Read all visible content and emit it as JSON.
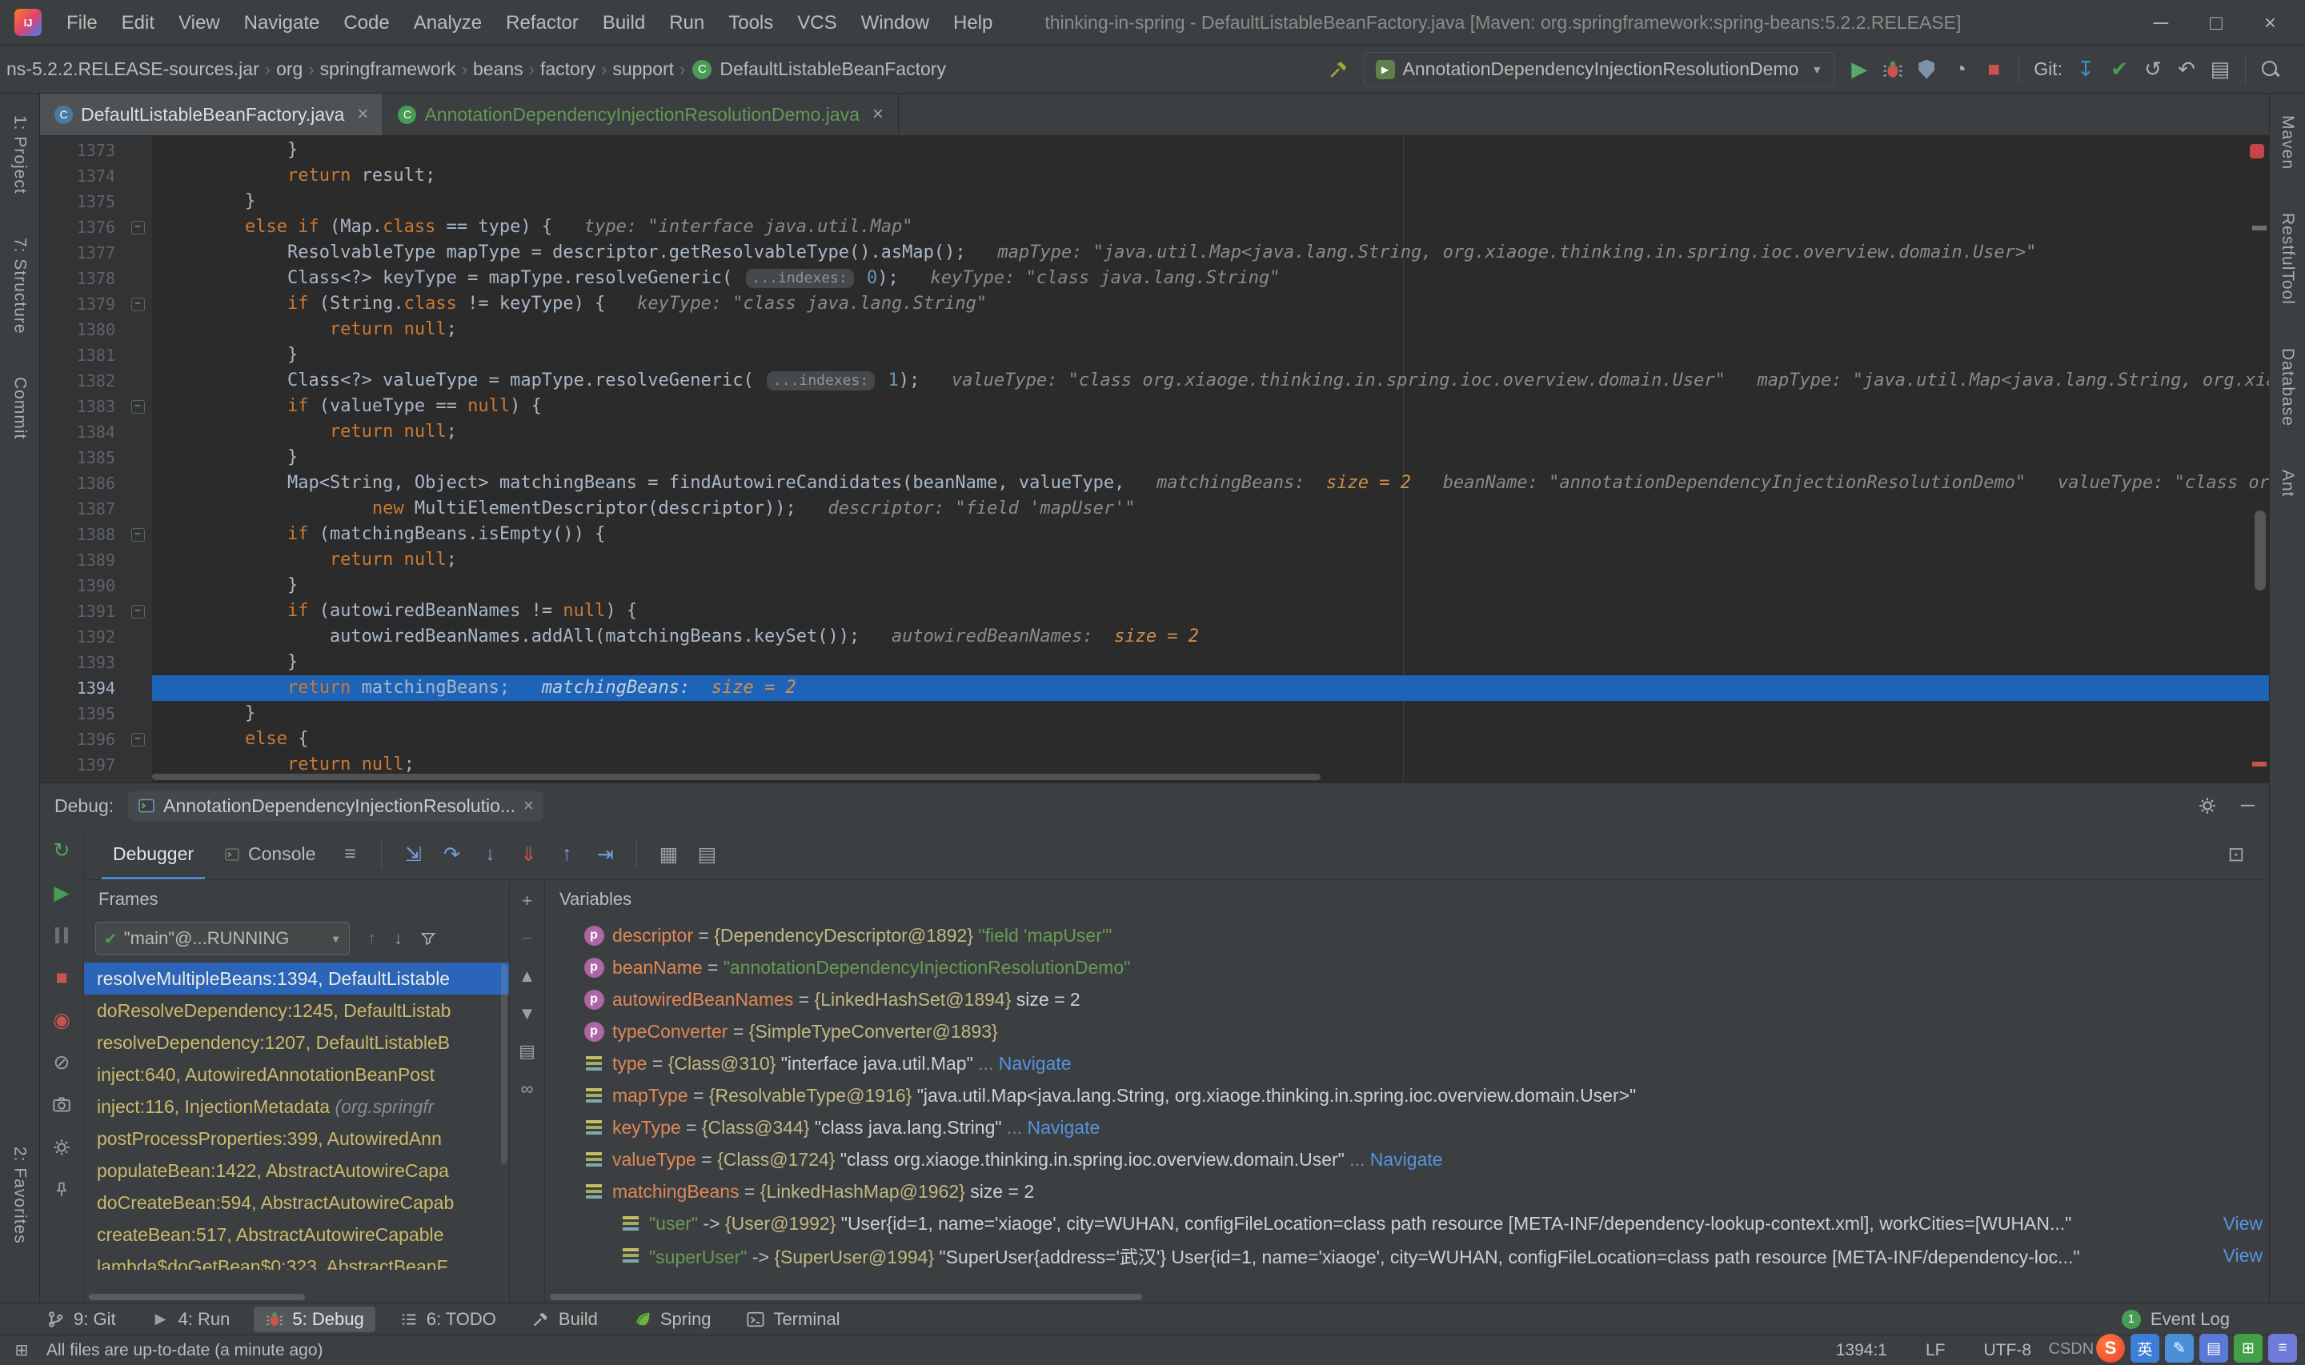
{
  "window": {
    "title": "thinking-in-spring - DefaultListableBeanFactory.java [Maven: org.springframework:spring-beans:5.2.2.RELEASE]",
    "controls": {
      "minimize": "─",
      "maximize": "□",
      "close": "×"
    }
  },
  "menu": {
    "items": [
      "File",
      "Edit",
      "View",
      "Navigate",
      "Code",
      "Analyze",
      "Refactor",
      "Build",
      "Run",
      "Tools",
      "VCS",
      "Window",
      "Help"
    ]
  },
  "navbar": {
    "breadcrumbs": [
      "ns-5.2.2.RELEASE-sources.jar",
      "org",
      "springframework",
      "beans",
      "factory",
      "support"
    ],
    "breadcrumb_class": "DefaultListableBeanFactory",
    "run_config": "AnnotationDependencyInjectionResolutionDemo",
    "git_label": "Git:"
  },
  "tabs": [
    {
      "label": "DefaultListableBeanFactory.java",
      "close": "×",
      "active": true,
      "color": "#4A7A9F",
      "green": false
    },
    {
      "label": "AnnotationDependencyInjectionResolutionDemo.java",
      "close": "×",
      "active": false,
      "color": "#499C54",
      "green": true
    }
  ],
  "left_stripe": {
    "top": [
      "1: Project",
      "7: Structure",
      "Commit"
    ],
    "bottom": [
      "2: Favorites"
    ]
  },
  "right_stripe": {
    "items": [
      "Maven",
      "RestfulTool",
      "Database",
      "Ant"
    ]
  },
  "editor": {
    "current_line": 1394,
    "lines": [
      {
        "n": 1373,
        "ind": 12,
        "seg": [
          [
            "p",
            "}"
          ]
        ]
      },
      {
        "n": 1374,
        "ind": 12,
        "seg": [
          [
            "k",
            "return"
          ],
          [
            "p",
            " result;"
          ]
        ]
      },
      {
        "n": 1375,
        "ind": 8,
        "seg": [
          [
            "p",
            "}"
          ]
        ]
      },
      {
        "n": 1376,
        "ind": 8,
        "fold": true,
        "seg": [
          [
            "k",
            "else"
          ],
          [
            "p",
            " "
          ],
          [
            "k",
            "if"
          ],
          [
            "p",
            " (Map."
          ],
          [
            "k",
            "class"
          ],
          [
            "p",
            " == type) {   "
          ],
          [
            "h",
            "type: \"interface java.util.Map\""
          ]
        ]
      },
      {
        "n": 1377,
        "ind": 12,
        "seg": [
          [
            "p",
            "ResolvableType mapType = descriptor.getResolvableType().asMap();   "
          ],
          [
            "h",
            "mapType: \"java.util.Map<java.lang.String, org.xiaoge.thinking.in.spring.ioc.overview.domain.User>\""
          ]
        ]
      },
      {
        "n": 1378,
        "ind": 12,
        "seg": [
          [
            "p",
            "Class<?> keyType = mapType.resolveGeneric( "
          ],
          [
            "pill",
            "...indexes:"
          ],
          [
            "p",
            " "
          ],
          [
            "n",
            "0"
          ],
          [
            "p",
            ");   "
          ],
          [
            "h",
            "keyType: \"class java.lang.String\""
          ]
        ]
      },
      {
        "n": 1379,
        "ind": 12,
        "fold": true,
        "seg": [
          [
            "k",
            "if"
          ],
          [
            "p",
            " (String."
          ],
          [
            "k",
            "class"
          ],
          [
            "p",
            " != keyType) {   "
          ],
          [
            "h",
            "keyType: \"class java.lang.String\""
          ]
        ]
      },
      {
        "n": 1380,
        "ind": 16,
        "seg": [
          [
            "k",
            "return"
          ],
          [
            "p",
            " "
          ],
          [
            "k",
            "null"
          ],
          [
            "p",
            ";"
          ]
        ]
      },
      {
        "n": 1381,
        "ind": 12,
        "seg": [
          [
            "p",
            "}"
          ]
        ]
      },
      {
        "n": 1382,
        "ind": 12,
        "seg": [
          [
            "p",
            "Class<?> valueType = mapType.resolveGeneric( "
          ],
          [
            "pill",
            "...indexes:"
          ],
          [
            "p",
            " "
          ],
          [
            "n",
            "1"
          ],
          [
            "p",
            ");   "
          ],
          [
            "h",
            "valueType: \"class org.xiaoge.thinking.in.spring.ioc.overview.domain.User\"   mapType: \"java.util.Map<java.lang.String, org.xiaoge.thinking.in.spring.ioc.o"
          ]
        ]
      },
      {
        "n": 1383,
        "ind": 12,
        "fold": true,
        "seg": [
          [
            "k",
            "if"
          ],
          [
            "p",
            " (valueType == "
          ],
          [
            "k",
            "null"
          ],
          [
            "p",
            ") {"
          ]
        ]
      },
      {
        "n": 1384,
        "ind": 16,
        "seg": [
          [
            "k",
            "return"
          ],
          [
            "p",
            " "
          ],
          [
            "k",
            "null"
          ],
          [
            "p",
            ";"
          ]
        ]
      },
      {
        "n": 1385,
        "ind": 12,
        "seg": [
          [
            "p",
            "}"
          ]
        ]
      },
      {
        "n": 1386,
        "ind": 12,
        "seg": [
          [
            "p",
            "Map<String, Object> matchingBeans = findAutowireCandidates(beanName, valueType,   "
          ],
          [
            "h",
            "matchingBeans:  "
          ],
          [
            "ho",
            "size = 2"
          ],
          [
            "h",
            "   beanName: \"annotationDependencyInjectionResolutionDemo\"   valueType: \"class org.xiaoge.thinking.in.sprin"
          ]
        ]
      },
      {
        "n": 1387,
        "ind": 20,
        "seg": [
          [
            "k",
            "new"
          ],
          [
            "p",
            " MultiElementDescriptor(descriptor));   "
          ],
          [
            "h",
            "descriptor: \"field 'mapUser'\""
          ]
        ]
      },
      {
        "n": 1388,
        "ind": 12,
        "fold": true,
        "seg": [
          [
            "k",
            "if"
          ],
          [
            "p",
            " (matchingBeans.isEmpty()) {"
          ]
        ]
      },
      {
        "n": 1389,
        "ind": 16,
        "seg": [
          [
            "k",
            "return"
          ],
          [
            "p",
            " "
          ],
          [
            "k",
            "null"
          ],
          [
            "p",
            ";"
          ]
        ]
      },
      {
        "n": 1390,
        "ind": 12,
        "seg": [
          [
            "p",
            "}"
          ]
        ]
      },
      {
        "n": 1391,
        "ind": 12,
        "fold": true,
        "seg": [
          [
            "k",
            "if"
          ],
          [
            "p",
            " (autowiredBeanNames != "
          ],
          [
            "k",
            "null"
          ],
          [
            "p",
            ") {"
          ]
        ]
      },
      {
        "n": 1392,
        "ind": 16,
        "seg": [
          [
            "p",
            "autowiredBeanNames.addAll(matchingBeans.keySet());   "
          ],
          [
            "h",
            "autowiredBeanNames:  "
          ],
          [
            "ho",
            "size = 2"
          ]
        ]
      },
      {
        "n": 1393,
        "ind": 12,
        "seg": [
          [
            "p",
            "}"
          ]
        ]
      },
      {
        "n": 1394,
        "ind": 12,
        "current": true,
        "seg": [
          [
            "k",
            "return"
          ],
          [
            "p",
            " matchingBeans;   "
          ],
          [
            "h",
            "matchingBeans:  "
          ],
          [
            "ho",
            "size = 2"
          ]
        ]
      },
      {
        "n": 1395,
        "ind": 8,
        "seg": [
          [
            "p",
            "}"
          ]
        ]
      },
      {
        "n": 1396,
        "ind": 8,
        "fold": true,
        "seg": [
          [
            "k",
            "else"
          ],
          [
            "p",
            " {"
          ]
        ]
      },
      {
        "n": 1397,
        "ind": 12,
        "seg": [
          [
            "k",
            "return"
          ],
          [
            "p",
            " "
          ],
          [
            "k",
            "null"
          ],
          [
            "p",
            ";"
          ]
        ]
      }
    ]
  },
  "debug": {
    "header_label": "Debug:",
    "tab_label": "AnnotationDependencyInjectionResolutio...",
    "tab_close": "×",
    "tabs": {
      "debugger": "Debugger",
      "console": "Console"
    },
    "frames": {
      "header": "Frames",
      "thread": "\"main\"@...RUNNING",
      "items": [
        {
          "text": "resolveMultipleBeans:1394, DefaultListable",
          "selected": true
        },
        {
          "text": "doResolveDependency:1245, DefaultListab"
        },
        {
          "text": "resolveDependency:1207, DefaultListableB"
        },
        {
          "text": "inject:640, AutowiredAnnotationBeanPost"
        },
        {
          "text": "inject:116, InjectionMetadata ",
          "suffix": "(org.springfr"
        },
        {
          "text": "postProcessProperties:399, AutowiredAnn"
        },
        {
          "text": "populateBean:1422, AbstractAutowireCapa"
        },
        {
          "text": "doCreateBean:594, AbstractAutowireCapab"
        },
        {
          "text": "createBean:517, AbstractAutowireCapable"
        },
        {
          "text": "lambda$doGetBean$0:323, AbstractBeanF",
          "clipped": true
        }
      ]
    },
    "variables": {
      "header": "Variables",
      "rows": [
        {
          "expand": "closed",
          "icon": "param",
          "ind": 0,
          "seg": [
            [
              "name",
              "descriptor"
            ],
            [
              "p",
              " = "
            ],
            [
              "ref",
              "{DependencyDescriptor@1892} "
            ],
            [
              "str",
              "\"field 'mapUser'\""
            ]
          ]
        },
        {
          "expand": "closed",
          "icon": "param",
          "ind": 0,
          "seg": [
            [
              "name",
              "beanName"
            ],
            [
              "p",
              " = "
            ],
            [
              "str",
              "\"annotationDependencyInjectionResolutionDemo\""
            ]
          ]
        },
        {
          "expand": "closed",
          "icon": "param",
          "ind": 0,
          "seg": [
            [
              "name",
              "autowiredBeanNames"
            ],
            [
              "p",
              " = "
            ],
            [
              "ref",
              "{LinkedHashSet@1894} "
            ],
            [
              "val",
              " size = 2"
            ]
          ]
        },
        {
          "expand": "closed",
          "icon": "param",
          "ind": 0,
          "seg": [
            [
              "name",
              "typeConverter"
            ],
            [
              "p",
              " = "
            ],
            [
              "ref",
              "{SimpleTypeConverter@1893}"
            ]
          ]
        },
        {
          "expand": "closed",
          "icon": "var",
          "ind": 0,
          "seg": [
            [
              "name",
              "type"
            ],
            [
              "p",
              " = "
            ],
            [
              "ref",
              "{Class@310} "
            ],
            [
              "val",
              "\"interface java.util.Map\""
            ],
            [
              "dots",
              " ... "
            ],
            [
              "link",
              "Navigate"
            ]
          ]
        },
        {
          "expand": "closed",
          "icon": "var",
          "ind": 0,
          "seg": [
            [
              "name",
              "mapType"
            ],
            [
              "p",
              " = "
            ],
            [
              "ref",
              "{ResolvableType@1916} "
            ],
            [
              "val",
              "\"java.util.Map<java.lang.String, org.xiaoge.thinking.in.spring.ioc.overview.domain.User>\""
            ]
          ]
        },
        {
          "expand": "closed",
          "icon": "var",
          "ind": 0,
          "seg": [
            [
              "name",
              "keyType"
            ],
            [
              "p",
              " = "
            ],
            [
              "ref",
              "{Class@344} "
            ],
            [
              "val",
              "\"class java.lang.String\""
            ],
            [
              "dots",
              " ... "
            ],
            [
              "link",
              "Navigate"
            ]
          ]
        },
        {
          "expand": "closed",
          "icon": "var",
          "ind": 0,
          "seg": [
            [
              "name",
              "valueType"
            ],
            [
              "p",
              " = "
            ],
            [
              "ref",
              "{Class@1724} "
            ],
            [
              "val",
              "\"class org.xiaoge.thinking.in.spring.ioc.overview.domain.User\""
            ],
            [
              "dots",
              " ... "
            ],
            [
              "link",
              "Navigate"
            ]
          ]
        },
        {
          "expand": "open",
          "icon": "var",
          "ind": 0,
          "seg": [
            [
              "name",
              "matchingBeans"
            ],
            [
              "p",
              " = "
            ],
            [
              "ref",
              "{LinkedHashMap@1962} "
            ],
            [
              "val",
              " size = 2"
            ]
          ]
        },
        {
          "expand": "closed",
          "icon": "var",
          "ind": 1,
          "view": "View",
          "seg": [
            [
              "str",
              "\"user\""
            ],
            [
              "p",
              " -> "
            ],
            [
              "ref",
              "{User@1992} "
            ],
            [
              "val",
              "\"User{id=1, name='xiaoge', city=WUHAN, configFileLocation=class path resource [META-INF/dependency-lookup-context.xml], workCities=[WUHAN...\""
            ]
          ]
        },
        {
          "expand": "closed",
          "icon": "var",
          "ind": 1,
          "view": "View",
          "seg": [
            [
              "str",
              "\"superUser\""
            ],
            [
              "p",
              " -> "
            ],
            [
              "ref",
              "{SuperUser@1994} "
            ],
            [
              "val",
              "\"SuperUser{address='武汉'} User{id=1, name='xiaoge', city=WUHAN, configFileLocation=class path resource [META-INF/dependency-loc...\""
            ]
          ]
        }
      ]
    }
  },
  "bottom_bar": {
    "left": [
      {
        "icon": "git",
        "label": "9: Git"
      },
      {
        "icon": "run",
        "label": "4: Run"
      },
      {
        "icon": "bug",
        "label": "5: Debug",
        "active": true
      },
      {
        "icon": "todo",
        "label": "6: TODO"
      },
      {
        "icon": "build",
        "label": "Build"
      },
      {
        "icon": "spring",
        "label": "Spring"
      },
      {
        "icon": "terminal",
        "label": "Terminal"
      }
    ],
    "right": {
      "badge": "1",
      "label": "Event Log"
    }
  },
  "status_bar": {
    "message": "All files are up-to-date (a minute ago)",
    "position": "1394:1",
    "line_separator": "LF",
    "encoding": "UTF-8",
    "watermark": "CSDN @",
    "ime_lang": "英",
    "sogou": "S"
  },
  "icons": {
    "crumb_sep": "›",
    "play": "▶",
    "stop": "■",
    "check": "✔",
    "update": "↧",
    "history": "↺",
    "revert": "↶",
    "diff": "▤",
    "profiler": "◔",
    "burger": "≡",
    "exec_point": "⇲",
    "step_over": "↷",
    "step_into": "↓",
    "force_step_into": "⇓",
    "step_out": "↑",
    "run_to_cursor": "⇥",
    "grid": "▦",
    "rows": "▤",
    "layout": "⊡",
    "rerun": "↻",
    "view_bp": "◉",
    "mute_bp": "⊘",
    "arrow_up": "↑",
    "arrow_down": "↓",
    "plus": "+",
    "minus": "−",
    "up": "▲",
    "down": "▼",
    "copy": "▤",
    "infinity": "∞",
    "hide": "─",
    "caret": "▼",
    "corner": "⊞",
    "class_letter": "C",
    "rc_play": "▶"
  }
}
